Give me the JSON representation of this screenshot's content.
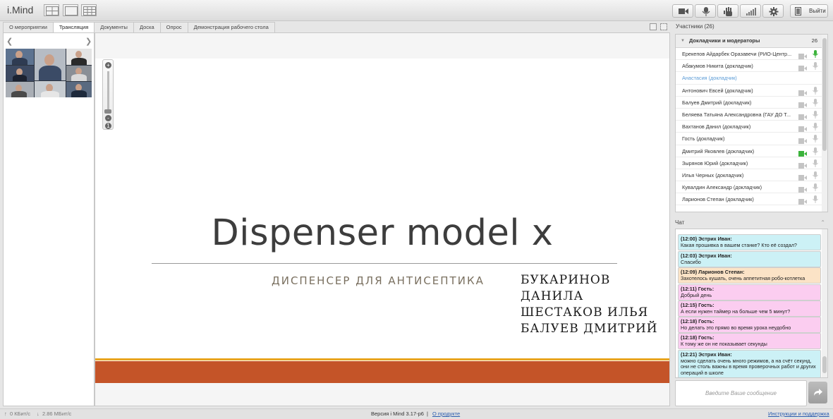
{
  "app": {
    "logo": "i.Mind",
    "exit_label": "Выйти"
  },
  "tabs": [
    {
      "label": "О мероприятии",
      "active": false
    },
    {
      "label": "Трансляция",
      "active": true
    },
    {
      "label": "Документы",
      "active": false
    },
    {
      "label": "Доска",
      "active": false
    },
    {
      "label": "Опрос",
      "active": false
    },
    {
      "label": "Демонстрация рабочего стола",
      "active": false
    }
  ],
  "slide": {
    "title": "Dispenser model x",
    "subtitle": "ДИСПЕНСЕР ДЛЯ АНТИСЕПТИКА",
    "authors": [
      "БУКАРИНОВ",
      "ДАНИЛА",
      "ШЕСТАКОВ ИЛЬЯ",
      "БАЛУЕВ ДМИТРИЙ"
    ]
  },
  "participants": {
    "header": "Участники (26)",
    "group_title": "Докладчики и модераторы",
    "group_count": "26",
    "rows": [
      {
        "name": "Ерекепов Айдарбек Оразавечи (РИО-Центр...",
        "cam": "off",
        "mic": "active",
        "style": "normal"
      },
      {
        "name": "Абакумов Никита (докладчик)",
        "cam": "off",
        "mic": "off",
        "style": "normal"
      },
      {
        "name": "Анастасия (докладчик)",
        "cam": "none",
        "mic": "none",
        "style": "blue"
      },
      {
        "name": "Антонович Евсей (докладчик)",
        "cam": "off",
        "mic": "off",
        "style": "normal"
      },
      {
        "name": "Балуев Дмитрий (докладчик)",
        "cam": "off",
        "mic": "off",
        "style": "normal"
      },
      {
        "name": "Беляева Татьяна Александровна (ГАУ ДО Т...",
        "cam": "off",
        "mic": "off",
        "style": "normal"
      },
      {
        "name": "Вахтанов Данил (докладчик)",
        "cam": "off",
        "mic": "off",
        "style": "normal"
      },
      {
        "name": "Гость (докладчик)",
        "cam": "off",
        "mic": "off",
        "style": "normal"
      },
      {
        "name": "Дмитрий Яковлев (докладчик)",
        "cam": "active",
        "mic": "off",
        "style": "normal"
      },
      {
        "name": "Зырянов Юрий (докладчик)",
        "cam": "off",
        "mic": "off",
        "style": "normal"
      },
      {
        "name": "Илья Черных (докладчик)",
        "cam": "off",
        "mic": "off",
        "style": "normal"
      },
      {
        "name": "Кувалдин Александр (докладчик)",
        "cam": "off",
        "mic": "off",
        "style": "normal"
      },
      {
        "name": "Ларионов Степан (докладчик)",
        "cam": "off",
        "mic": "off",
        "style": "normal"
      }
    ]
  },
  "chat": {
    "header": "Чат",
    "messages": [
      {
        "head": "(12:00) Эстрих Иван:",
        "text": "Какая прошивка в вашем станке? Кто её создал?",
        "color": "cyan"
      },
      {
        "head": "(12:03) Эстрих Иван:",
        "text": "Спасибо",
        "color": "cyan"
      },
      {
        "head": "(12:09) Ларионов Степан:",
        "text": "Захотелось кушать, очень аппетитная робо-котлетка",
        "color": "orange"
      },
      {
        "head": "(12:11) Гость:",
        "text": "Добрый день",
        "color": "pink"
      },
      {
        "head": "(12:15) Гость:",
        "text": "А если нужен таймер на больше чем 5 минут?",
        "color": "pink"
      },
      {
        "head": "(12:18) Гость:",
        "text": "Но делать это прямо во время урока неудобно",
        "color": "pink"
      },
      {
        "head": "(12:18) Гость:",
        "text": "К тому же он не показывает секунды",
        "color": "pink"
      },
      {
        "head": "(12:21) Эстрих Иван:",
        "text": "можно сделать очень много режимов, а на счёт секунд, они не столь важны в время проверочных работ и других операций в школе",
        "color": "cyan"
      }
    ],
    "input_placeholder": "Введите Ваше сообщение"
  },
  "status": {
    "upload": "0 КБит/с",
    "download": "2.86 МБит/с",
    "version": "Версия i Mind 3.17-р6",
    "separator": "|",
    "about_link": "О продукте",
    "help_link": "Инструкции и поддержка"
  },
  "colors": {
    "accent_orange": "#c45428",
    "accent_gold": "#e8a51f",
    "chat_cyan": "#ccf1f6",
    "chat_orange": "#fbe3c6",
    "chat_pink": "#fbcdf0",
    "mic_active": "#3bb33b"
  }
}
